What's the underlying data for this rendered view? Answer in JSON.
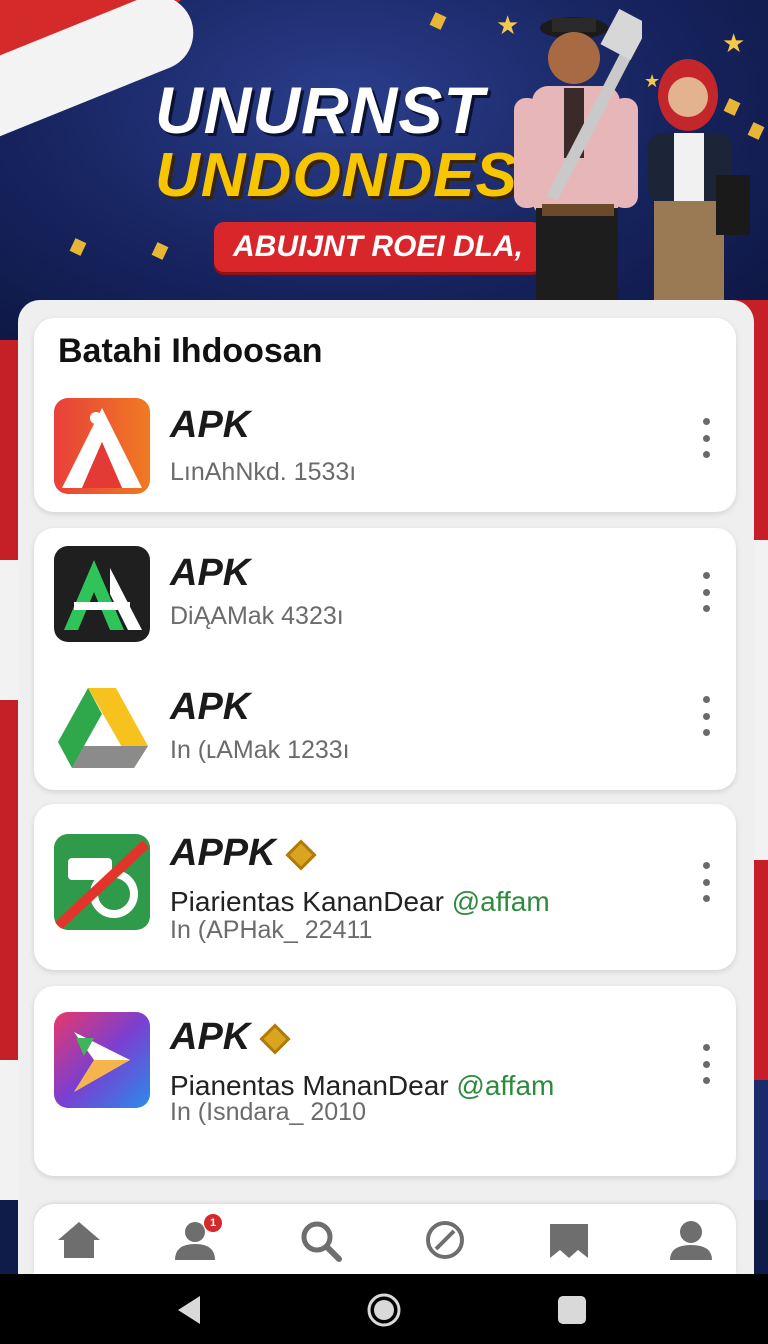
{
  "banner": {
    "title_line1": "UNURNST",
    "title_line2": "UNDONDESIN",
    "subtitle": "ABUIJNT ROEI DLA,"
  },
  "section": {
    "title": "Batahi Ihdoosan"
  },
  "apps": [
    {
      "name": "APK",
      "meta": "LınAhNkd. 1533ı"
    },
    {
      "name": "APK",
      "meta": "DiĄAMak 4323ı"
    },
    {
      "name": "APK",
      "meta": "In (ʟAMak 1233ı"
    },
    {
      "name": "APPK",
      "developer": "Piarientas KananDear",
      "handle": "@affam",
      "meta": "In (APHak_ 22411"
    },
    {
      "name": "APK",
      "developer": "Pianentas MananDear",
      "handle": "@affam",
      "meta": "In (Isndara_ 2010"
    }
  ],
  "bottom_nav": {
    "items": [
      "home-icon",
      "people-icon",
      "search-icon",
      "compass-icon",
      "library-icon",
      "profile-icon"
    ],
    "notification_count": "1"
  },
  "colors": {
    "accent_green": "#2f8a3e",
    "banner_red": "#d8262b",
    "banner_yellow": "#f7c600"
  }
}
